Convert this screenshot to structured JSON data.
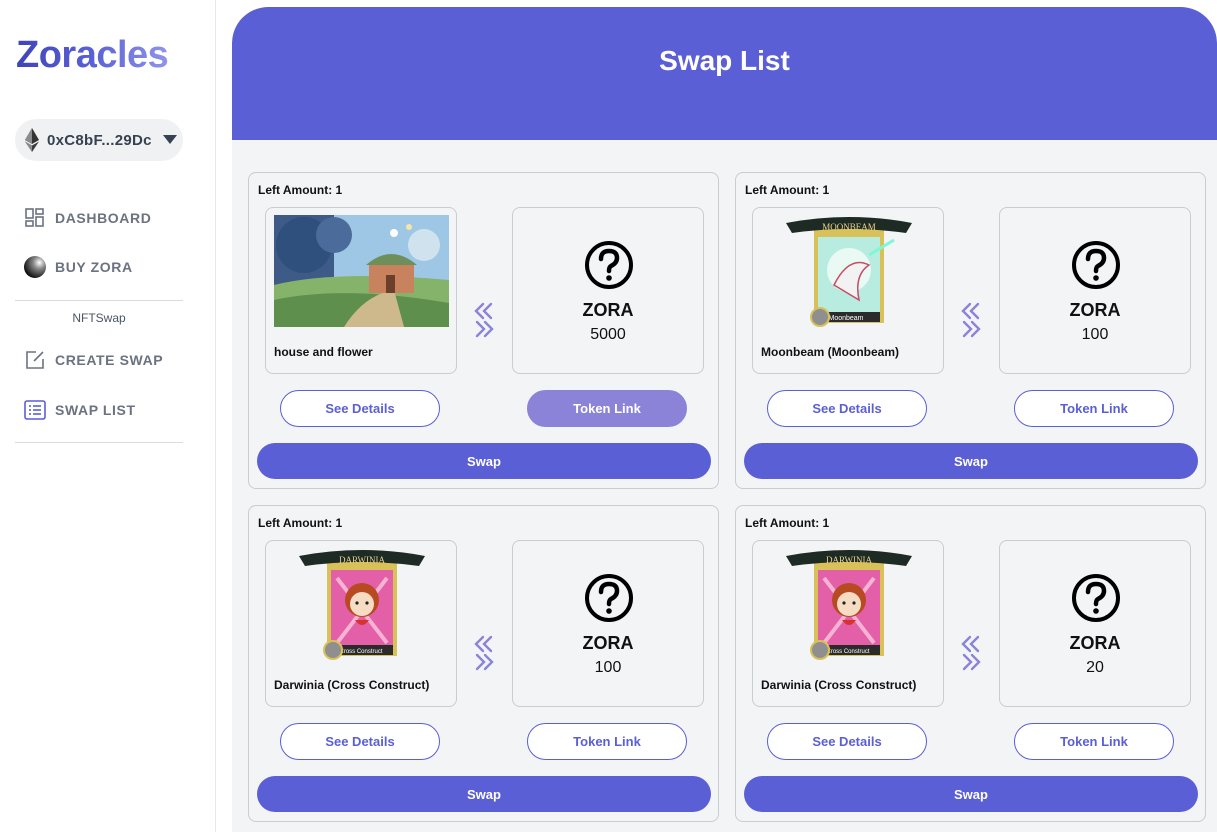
{
  "app": {
    "logo": "Zoracles"
  },
  "wallet": {
    "address": "0xC8bF...29Dc",
    "icon": "ethereum-icon"
  },
  "sidebar": {
    "items": [
      {
        "label": "DASHBOARD",
        "icon": "dashboard-grid-icon"
      },
      {
        "label": "BUY ZORA",
        "icon": "zora-orb-icon"
      }
    ],
    "section_label": "NFTSwap",
    "section_items": [
      {
        "label": "CREATE SWAP",
        "icon": "edit-square-icon"
      },
      {
        "label": "SWAP LIST",
        "icon": "list-icon"
      }
    ]
  },
  "page": {
    "title": "Swap List"
  },
  "colors": {
    "accent": "#5a5fd6",
    "accent_light": "#8b83d8",
    "background": "#f3f4f6"
  },
  "swaps": [
    {
      "left_amount": "Left Amount: 1",
      "nft_name": "house and flower",
      "nft_image": "landscape",
      "token_symbol": "ZORA",
      "token_amount": "5000",
      "details_label": "See Details",
      "token_link_label": "Token Link",
      "swap_label": "Swap"
    },
    {
      "left_amount": "Left Amount: 1",
      "nft_name": "Moonbeam (Moonbeam)",
      "nft_image": "moonbeam-card",
      "card_banner": "MOONBEAM",
      "card_caption": "Moonbeam",
      "token_symbol": "ZORA",
      "token_amount": "100",
      "details_label": "See Details",
      "token_link_label": "Token Link",
      "swap_label": "Swap"
    },
    {
      "left_amount": "Left Amount: 1",
      "nft_name": "Darwinia (Cross Construct)",
      "nft_image": "darwinia-card",
      "card_banner": "DARWINIA",
      "card_caption": "Cross Construct",
      "token_symbol": "ZORA",
      "token_amount": "100",
      "details_label": "See Details",
      "token_link_label": "Token Link",
      "swap_label": "Swap"
    },
    {
      "left_amount": "Left Amount: 1",
      "nft_name": "Darwinia (Cross Construct)",
      "nft_image": "darwinia-card",
      "card_banner": "DARWINIA",
      "card_caption": "Cross Construct",
      "token_symbol": "ZORA",
      "token_amount": "20",
      "details_label": "See Details",
      "token_link_label": "Token Link",
      "swap_label": "Swap"
    }
  ]
}
